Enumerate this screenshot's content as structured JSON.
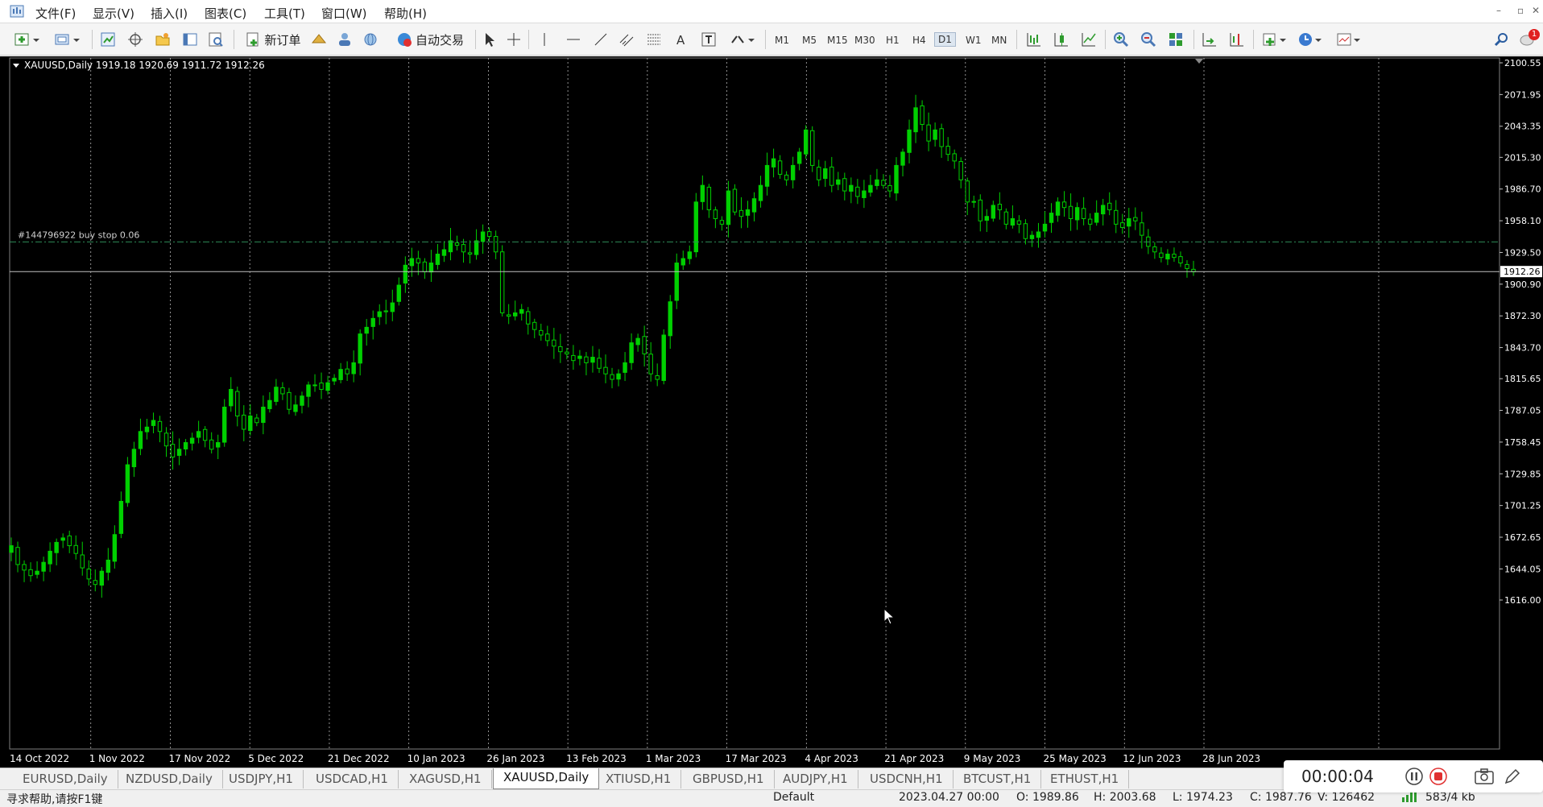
{
  "menubar": {
    "items": [
      "文件(F)",
      "显示(V)",
      "插入(I)",
      "图表(C)",
      "工具(T)",
      "窗口(W)",
      "帮助(H)"
    ]
  },
  "toolbar": {
    "new_order_label": "新订单",
    "autotrading_label": "自动交易",
    "timeframes": [
      "M1",
      "M5",
      "M15",
      "M30",
      "H1",
      "H4",
      "D1",
      "W1",
      "MN"
    ],
    "selected_timeframe": "D1",
    "notification_count": "1"
  },
  "chart": {
    "header": "XAUUSD,Daily  1919.18 1920.69 1911.72 1912.26",
    "order_label": "#144796922 buy stop 0.06",
    "order_price": 1939.0,
    "current_price_label": "1912.26",
    "current_price": 1912.26,
    "price_axis": [
      "2100.55",
      "2071.95",
      "2043.35",
      "2015.30",
      "1986.70",
      "1958.10",
      "1929.50",
      "1900.90",
      "1872.30",
      "1843.70",
      "1815.65",
      "1787.05",
      "1758.45",
      "1729.85",
      "1701.25",
      "1672.65",
      "1644.05",
      "1616.00"
    ],
    "date_axis": [
      "14 Oct 2022",
      "1 Nov 2022",
      "17 Nov 2022",
      "5 Dec 2022",
      "21 Dec 2022",
      "10 Jan 2023",
      "26 Jan 2023",
      "13 Feb 2023",
      "1 Mar 2023",
      "17 Mar 2023",
      "4 Apr 2023",
      "21 Apr 2023",
      "9 May 2023",
      "25 May 2023",
      "12 Jun 2023",
      "28 Jun 2023"
    ],
    "colors": {
      "background": "#000000",
      "bull": "#00d000",
      "bear": "#000000",
      "wick": "#00d000",
      "grid": "#ffffff",
      "order_line": "#2e8b57",
      "price_line": "#c0c0c0",
      "text": "#ffffff"
    }
  },
  "chart_data": {
    "type": "candlestick",
    "symbol": "XAUUSD",
    "timeframe": "Daily",
    "ylim": [
      1616.0,
      2100.55
    ],
    "close_series": [
      1665,
      1648,
      1643,
      1638,
      1642,
      1650,
      1660,
      1668,
      1672,
      1665,
      1658,
      1645,
      1635,
      1630,
      1642,
      1652,
      1675,
      1705,
      1738,
      1752,
      1768,
      1772,
      1778,
      1768,
      1755,
      1745,
      1752,
      1758,
      1762,
      1768,
      1760,
      1752,
      1758,
      1790,
      1806,
      1782,
      1770,
      1782,
      1776,
      1790,
      1796,
      1808,
      1802,
      1788,
      1792,
      1800,
      1810,
      1810,
      1806,
      1812,
      1816,
      1824,
      1820,
      1830,
      1856,
      1862,
      1870,
      1876,
      1876,
      1884,
      1900,
      1918,
      1924,
      1920,
      1912,
      1920,
      1928,
      1932,
      1940,
      1936,
      1930,
      1928,
      1940,
      1948,
      1944,
      1930,
      1875,
      1872,
      1875,
      1878,
      1865,
      1860,
      1855,
      1850,
      1845,
      1840,
      1838,
      1832,
      1836,
      1830,
      1835,
      1825,
      1820,
      1815,
      1820,
      1830,
      1848,
      1852,
      1838,
      1820,
      1815,
      1855,
      1885,
      1920,
      1924,
      1930,
      1975,
      1990,
      1968,
      1960,
      1955,
      1985,
      1966,
      1962,
      1968,
      1978,
      1990,
      2008,
      2014,
      2000,
      1995,
      2008,
      2020,
      2040,
      2008,
      1995,
      2005,
      1990,
      1995,
      1985,
      1990,
      1980,
      1985,
      1990,
      1995,
      1990,
      1985,
      2008,
      2020,
      2040,
      2060,
      2045,
      2030,
      2040,
      2025,
      2018,
      2012,
      1995,
      1975,
      1975,
      1958,
      1962,
      1972,
      1968,
      1955,
      1960,
      1955,
      1942,
      1945,
      1948,
      1955,
      1965,
      1975,
      1970,
      1960,
      1970,
      1960,
      1955,
      1965,
      1972,
      1968,
      1955,
      1952,
      1960,
      1958,
      1945,
      1935,
      1930,
      1925,
      1928,
      1925,
      1920,
      1915,
      1912
    ]
  },
  "tabs": [
    "EURUSD,Daily",
    "NZDUSD,Daily",
    "USDJPY,H1",
    "USDCAD,H1",
    "XAGUSD,H1",
    "XAUUSD,Daily",
    "XTIUSD,H1",
    "GBPUSD,H1",
    "AUDJPY,H1",
    "USDCNH,H1",
    "BTCUST,H1",
    "ETHUST,H1"
  ],
  "active_tab": "XAUUSD,Daily",
  "statusbar": {
    "help": "寻求帮助,请按F1键",
    "profile": "Default",
    "datetime": "2023.04.27 00:00",
    "open": "O: 1989.86",
    "high": "H: 2003.68",
    "low": "L: 1974.23",
    "close": "C: 1987.76",
    "volume": "V: 126462",
    "traffic": "583/4 kb"
  },
  "recorder": {
    "time": "00:00:04"
  }
}
